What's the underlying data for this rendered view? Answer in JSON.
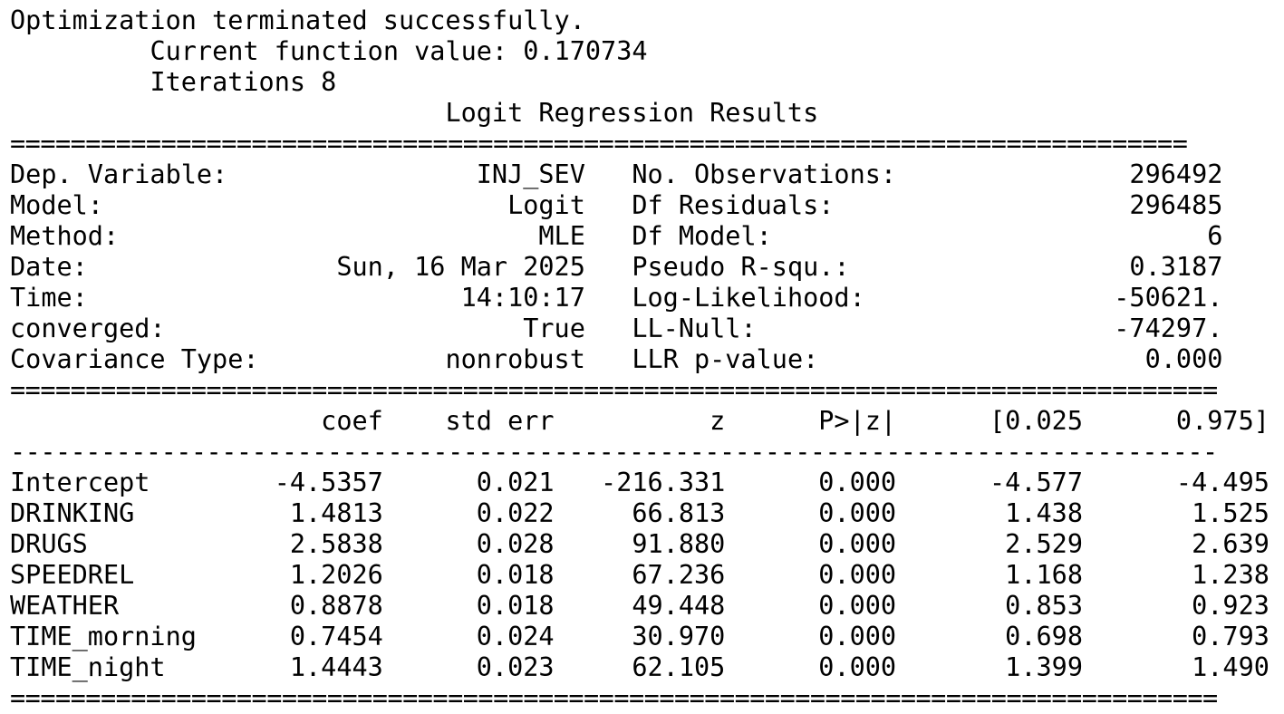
{
  "optimization": {
    "message": "Optimization terminated successfully.",
    "function_value_line": "Current function value: 0.170734",
    "iterations_line": "Iterations 8"
  },
  "title": "Logit Regression Results",
  "separators": {
    "top": "==============================================================================",
    "mid": "================================================================================",
    "dash": "--------------------------------------------------------------------------------",
    "bottom": "================================================================================"
  },
  "summary": [
    {
      "left_label": "Dep. Variable:",
      "left_value": "INJ_SEV",
      "right_label": "No. Observations:",
      "right_value": "296492"
    },
    {
      "left_label": "Model:",
      "left_value": "Logit",
      "right_label": "Df Residuals:",
      "right_value": "296485"
    },
    {
      "left_label": "Method:",
      "left_value": "MLE",
      "right_label": "Df Model:",
      "right_value": "6"
    },
    {
      "left_label": "Date:",
      "left_value": "Sun, 16 Mar 2025",
      "right_label": "Pseudo R-squ.:",
      "right_value": "0.3187"
    },
    {
      "left_label": "Time:",
      "left_value": "14:10:17",
      "right_label": "Log-Likelihood:",
      "right_value": "-50621."
    },
    {
      "left_label": "converged:",
      "left_value": "True",
      "right_label": "LL-Null:",
      "right_value": "-74297."
    },
    {
      "left_label": "Covariance Type:",
      "left_value": "nonrobust",
      "right_label": "LLR p-value:",
      "right_value": "0.000"
    }
  ],
  "columns": [
    "",
    "coef",
    "std err",
    "z",
    "P>|z|",
    "[0.025",
    "0.975]"
  ],
  "coefficients": [
    {
      "name": "Intercept",
      "coef": "-4.5357",
      "std_err": "0.021",
      "z": "-216.331",
      "p": "0.000",
      "ci_low": "-4.577",
      "ci_high": "-4.495"
    },
    {
      "name": "DRINKING",
      "coef": "1.4813",
      "std_err": "0.022",
      "z": "66.813",
      "p": "0.000",
      "ci_low": "1.438",
      "ci_high": "1.525"
    },
    {
      "name": "DRUGS",
      "coef": "2.5838",
      "std_err": "0.028",
      "z": "91.880",
      "p": "0.000",
      "ci_low": "2.529",
      "ci_high": "2.639"
    },
    {
      "name": "SPEEDREL",
      "coef": "1.2026",
      "std_err": "0.018",
      "z": "67.236",
      "p": "0.000",
      "ci_low": "1.168",
      "ci_high": "1.238"
    },
    {
      "name": "WEATHER",
      "coef": "0.8878",
      "std_err": "0.018",
      "z": "49.448",
      "p": "0.000",
      "ci_low": "0.853",
      "ci_high": "0.923"
    },
    {
      "name": "TIME_morning",
      "coef": "0.7454",
      "std_err": "0.024",
      "z": "30.970",
      "p": "0.000",
      "ci_low": "0.698",
      "ci_high": "0.793"
    },
    {
      "name": "TIME_night",
      "coef": "1.4443",
      "std_err": "0.023",
      "z": "62.105",
      "p": "0.000",
      "ci_low": "1.399",
      "ci_high": "1.490"
    }
  ]
}
